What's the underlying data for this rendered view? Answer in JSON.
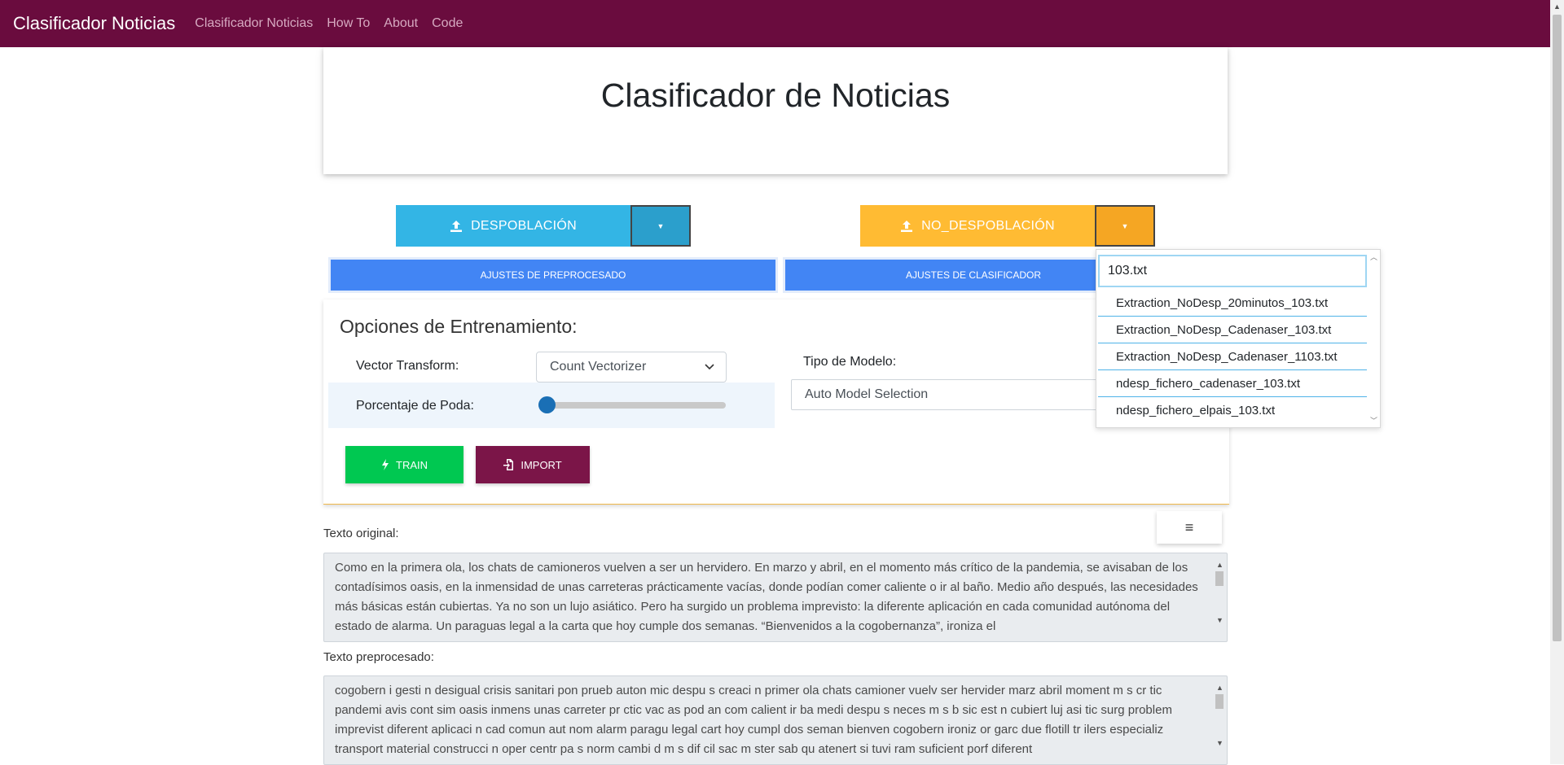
{
  "navbar": {
    "brand": "Clasificador Noticias",
    "links": [
      "Clasificador Noticias",
      "How To",
      "About",
      "Code"
    ]
  },
  "header": {
    "title": "Clasificador de Noticias"
  },
  "upload": {
    "despoblacion_label": "DESPOBLACIÓN",
    "no_despoblacion_label": "NO_DESPOBLACIÓN"
  },
  "settings": {
    "preprocess_label": "Ajustes de preprocesado",
    "classifier_label": "Ajustes de clasificador"
  },
  "training": {
    "title": "Opciones de Entrenamiento:",
    "vector_label": "Vector Transform:",
    "vector_value": "Count Vectorizer",
    "poda_label": "Porcentaje de Poda:",
    "poda_value": 0,
    "model_label": "Tipo de Modelo:",
    "model_value": "Auto Model Selection",
    "train_label": "TRAIN",
    "import_label": "IMPORT"
  },
  "dropdown": {
    "search_value": "103.txt",
    "items": [
      "Extraction_NoDesp_20minutos_103.txt",
      "Extraction_NoDesp_Cadenaser_103.txt",
      "Extraction_NoDesp_Cadenaser_1103.txt",
      "ndesp_fichero_cadenaser_103.txt",
      "ndesp_fichero_elpais_103.txt"
    ]
  },
  "texts": {
    "original_label": "Texto original:",
    "original_value": "Como en la primera ola, los chats de camioneros vuelven a ser un hervidero. En marzo y abril, en el momento más crítico de la pandemia, se avisaban de los contadísimos oasis, en la inmensidad de unas carreteras prácticamente vacías, donde podían comer caliente o ir al baño. Medio año después, las necesidades más básicas están cubiertas. Ya no son un lujo asiático. Pero ha surgido un problema imprevisto: la diferente aplicación en cada comunidad autónoma del estado de alarma. Un paraguas legal a la carta que hoy cumple dos semanas. “Bienvenidos a la cogobernanza”, ironiza el",
    "preprocessed_label": "Texto preprocesado:",
    "preprocessed_value": "cogobern i gesti n desigual crisis sanitari pon prueb auton mic despu s creaci n primer ola chats camioner vuelv ser hervider marz abril moment m s cr tic pandemi avis cont sim oasis inmens unas carreter pr ctic vac as pod an com calient ir ba medi despu s neces m s b sic est n cubiert luj asi tic surg problem imprevist diferent aplicaci n cad comun aut nom alarm paragu legal cart hoy cumpl dos seman bienven cogobern ironiz or garc due flotill tr ilers especializ transport material construcci n oper centr pa s norm cambi d m s dif cil sac m ster sab qu atenert si tuvi ram suficient porf diferent"
  },
  "colors": {
    "navbar": "#6a0c3e",
    "info": "#33b5e5",
    "warning": "#ffbb33",
    "primary": "#4285f4",
    "success": "#00c851",
    "secondary": "#7b1548"
  },
  "icons": {
    "upload": "upload-icon",
    "caret": "caret-down-icon",
    "bolt": "bolt-icon",
    "import": "file-import-icon",
    "menu": "hamburger-menu-icon"
  }
}
